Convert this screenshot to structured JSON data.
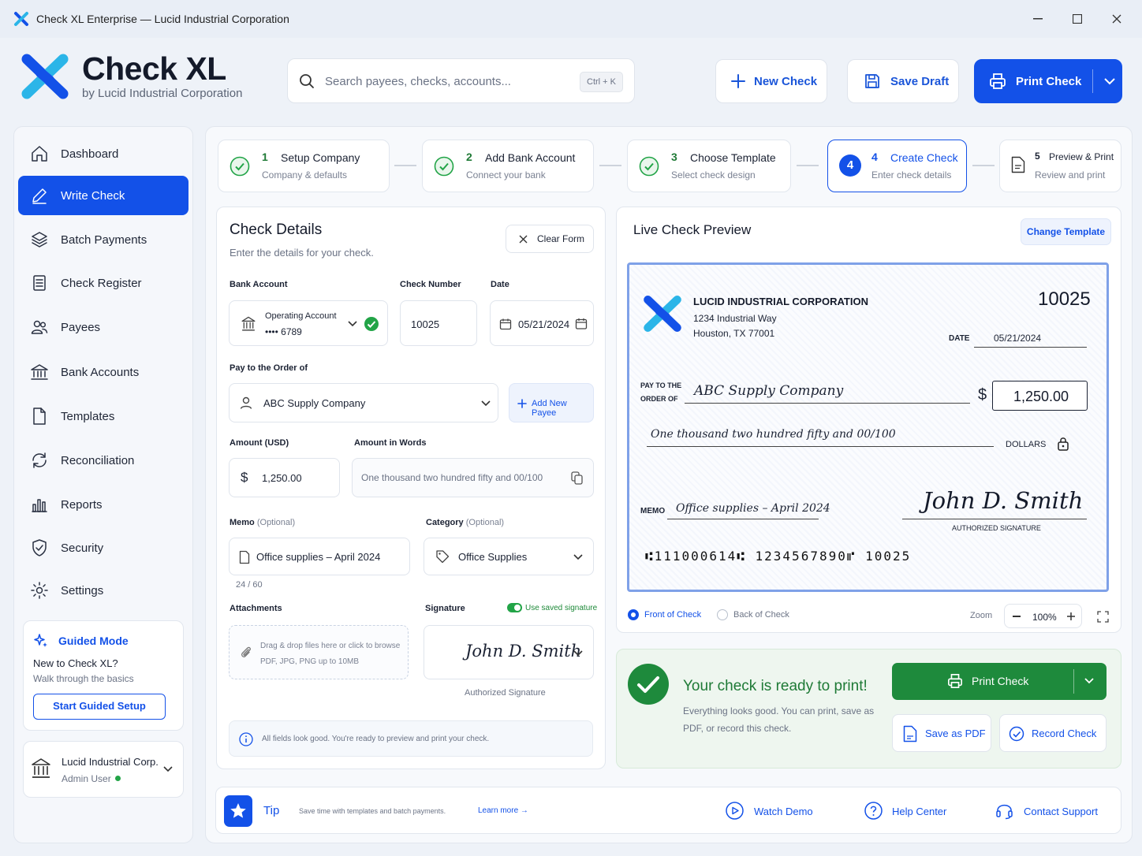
{
  "window": {
    "title": "Check XL Enterprise — Lucid Industrial Corporation"
  },
  "brand": {
    "name": "Check XL",
    "subtitle": "by Lucid Industrial Corporation",
    "accent": "#1351e8",
    "logo_secondary": "#2bb5e8"
  },
  "search": {
    "placeholder": "Search payees, checks, accounts...",
    "shortcut": "Ctrl + K"
  },
  "header": {
    "new_check": "New Check",
    "save_draft": "Save Draft",
    "print_check": "Print Check"
  },
  "sidebar": {
    "items": [
      {
        "label": "Dashboard",
        "icon": "home-icon"
      },
      {
        "label": "Write Check",
        "icon": "pen-icon",
        "active": true
      },
      {
        "label": "Batch Payments",
        "icon": "layers-icon"
      },
      {
        "label": "Check Register",
        "icon": "register-icon"
      },
      {
        "label": "Payees",
        "icon": "users-icon"
      },
      {
        "label": "Bank Accounts",
        "icon": "bank-icon"
      },
      {
        "label": "Templates",
        "icon": "file-icon"
      },
      {
        "label": "Reconciliation",
        "icon": "sync-icon"
      },
      {
        "label": "Reports",
        "icon": "bar-chart-icon"
      },
      {
        "label": "Security",
        "icon": "shield-icon"
      },
      {
        "label": "Settings",
        "icon": "gear-icon"
      }
    ],
    "guided": {
      "title": "Guided Mode",
      "line1": "New to Check XL?",
      "line2": "Walk through the basics",
      "button": "Start Guided Setup"
    },
    "user": {
      "company": "Lucid Industrial Corp.",
      "role": "Admin User",
      "status_color": "#22a447"
    }
  },
  "steps": [
    {
      "num": "1",
      "label": "Setup Company",
      "sub": "Company & defaults",
      "state": "done"
    },
    {
      "num": "2",
      "label": "Add Bank Account",
      "sub": "Connect your bank",
      "state": "done"
    },
    {
      "num": "3",
      "label": "Choose Template",
      "sub": "Select check design",
      "state": "done"
    },
    {
      "num": "4",
      "label": "Create Check",
      "sub": "Enter check details",
      "state": "active"
    },
    {
      "num": "5",
      "label": "Preview & Print",
      "sub": "Review and print",
      "state": "pending"
    }
  ],
  "form": {
    "title": "Check Details",
    "subtitle": "Enter the details for your check.",
    "clear": "Clear Form",
    "bank_label": "Bank Account",
    "bank_name": "Operating Account",
    "bank_number": "•••• 6789",
    "check_number_label": "Check Number",
    "check_number": "10025",
    "date_label": "Date",
    "date": "05/21/2024",
    "payee_label": "Pay to the Order of",
    "payee": "ABC Supply Company",
    "add_payee": "Add New Payee",
    "amount_label": "Amount (USD)",
    "amount_symbol": "$",
    "amount": "1,250.00",
    "words_label": "Amount in Words",
    "words": "One thousand two hundred fifty and 00/100",
    "memo_label": "Memo",
    "optional": "(Optional)",
    "memo": "Office supplies – April 2024",
    "memo_count": "24 / 60",
    "category_label": "Category",
    "category": "Office Supplies",
    "attachments_label": "Attachments",
    "attach_line1": "Drag & drop files here or click to browse",
    "attach_line2": "PDF, JPG, PNG up to 10MB",
    "signature_label": "Signature",
    "use_saved": "Use saved signature",
    "signature_caption": "Authorized Signature",
    "signature_script": "John D. Smith",
    "info": "All fields look good. You're ready to preview and print your check."
  },
  "preview": {
    "title": "Live Check Preview",
    "change_template": "Change Template",
    "company": "LUCID INDUSTRIAL CORPORATION",
    "address1": "1234 Industrial Way",
    "address2": "Houston, TX 77001",
    "number": "10025",
    "date_label": "DATE",
    "date": "05/21/2024",
    "pay_to_1": "PAY TO THE",
    "pay_to_2": "ORDER OF",
    "payee": "ABC Supply Company",
    "dollar": "$",
    "amount": "1,250.00",
    "words": "One thousand two hundred fifty and 00/100",
    "dollars": "DOLLARS",
    "memo_label": "MEMO",
    "memo": "Office supplies – April 2024",
    "signature": "John D. Smith",
    "sig_caption": "AUTHORIZED SIGNATURE",
    "micr": "⑆111000614⑆ 1234567890⑈ 10025",
    "front": "Front of Check",
    "back": "Back of Check",
    "zoom_label": "Zoom",
    "zoom": "100%"
  },
  "ready": {
    "title": "Your check is ready to print!",
    "line1": "Everything looks good. You can print, save as",
    "line2": "PDF, or record this check.",
    "print": "Print Check",
    "pdf": "Save as PDF",
    "record": "Record Check"
  },
  "tip": {
    "label": "Tip",
    "text": "Save time with templates and batch payments.",
    "learn": "Learn more →",
    "watch": "Watch Demo",
    "help": "Help Center",
    "contact": "Contact Support"
  }
}
